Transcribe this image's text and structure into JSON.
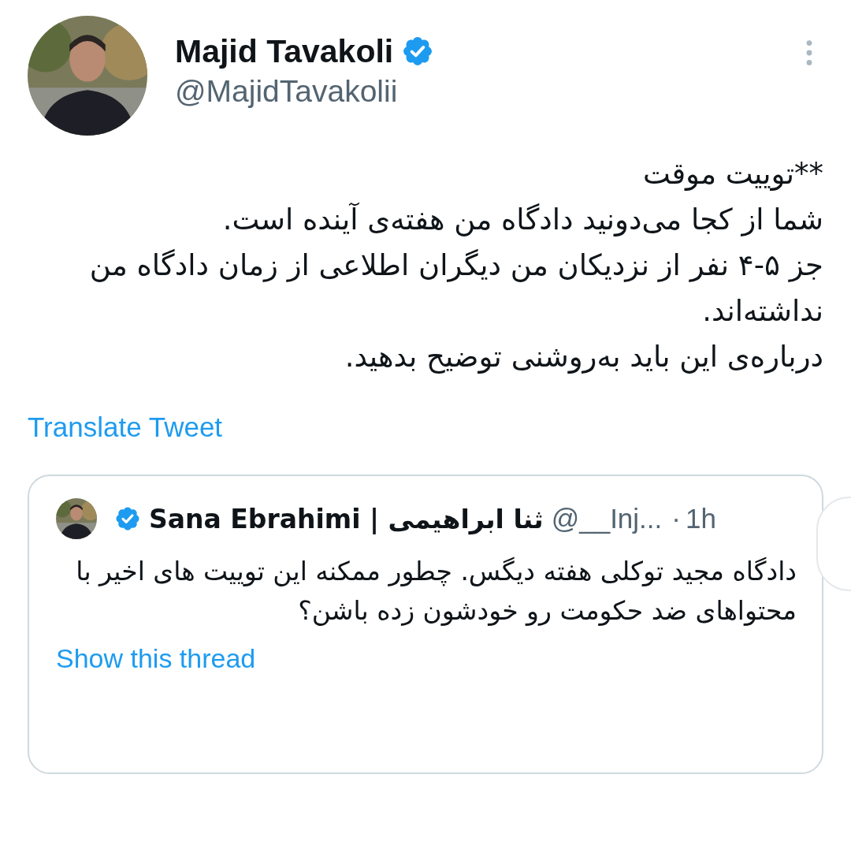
{
  "author": {
    "name": "Majid Tavakoli",
    "handle": "@MajidTavakolii",
    "verified": true
  },
  "tweet": {
    "lines": [
      "**توییت موقت",
      "شما از کجا می‌دونید دادگاه من هفته‌ی آینده است.",
      "جز ۵-۴ نفر از نزدیکان من دیگران اطلاعی از زمان دادگاه من نداشته‌اند.",
      "درباره‌ی این باید به‌روشنی توضیح بدهید."
    ]
  },
  "translate_link": "Translate Tweet",
  "quoted_tweet": {
    "author": {
      "name": "Sana Ebrahimi | ثنا ابراهیمی",
      "handle": "@__Inj...",
      "verified": true
    },
    "separator": "·",
    "time": "1h",
    "text": "دادگاه مجید توکلی هفته دیگس. چطور ممکنه این توییت های اخیر با محتواهای ضد حکومت رو خودشون زده باشن؟",
    "thread_link": "Show this thread"
  }
}
